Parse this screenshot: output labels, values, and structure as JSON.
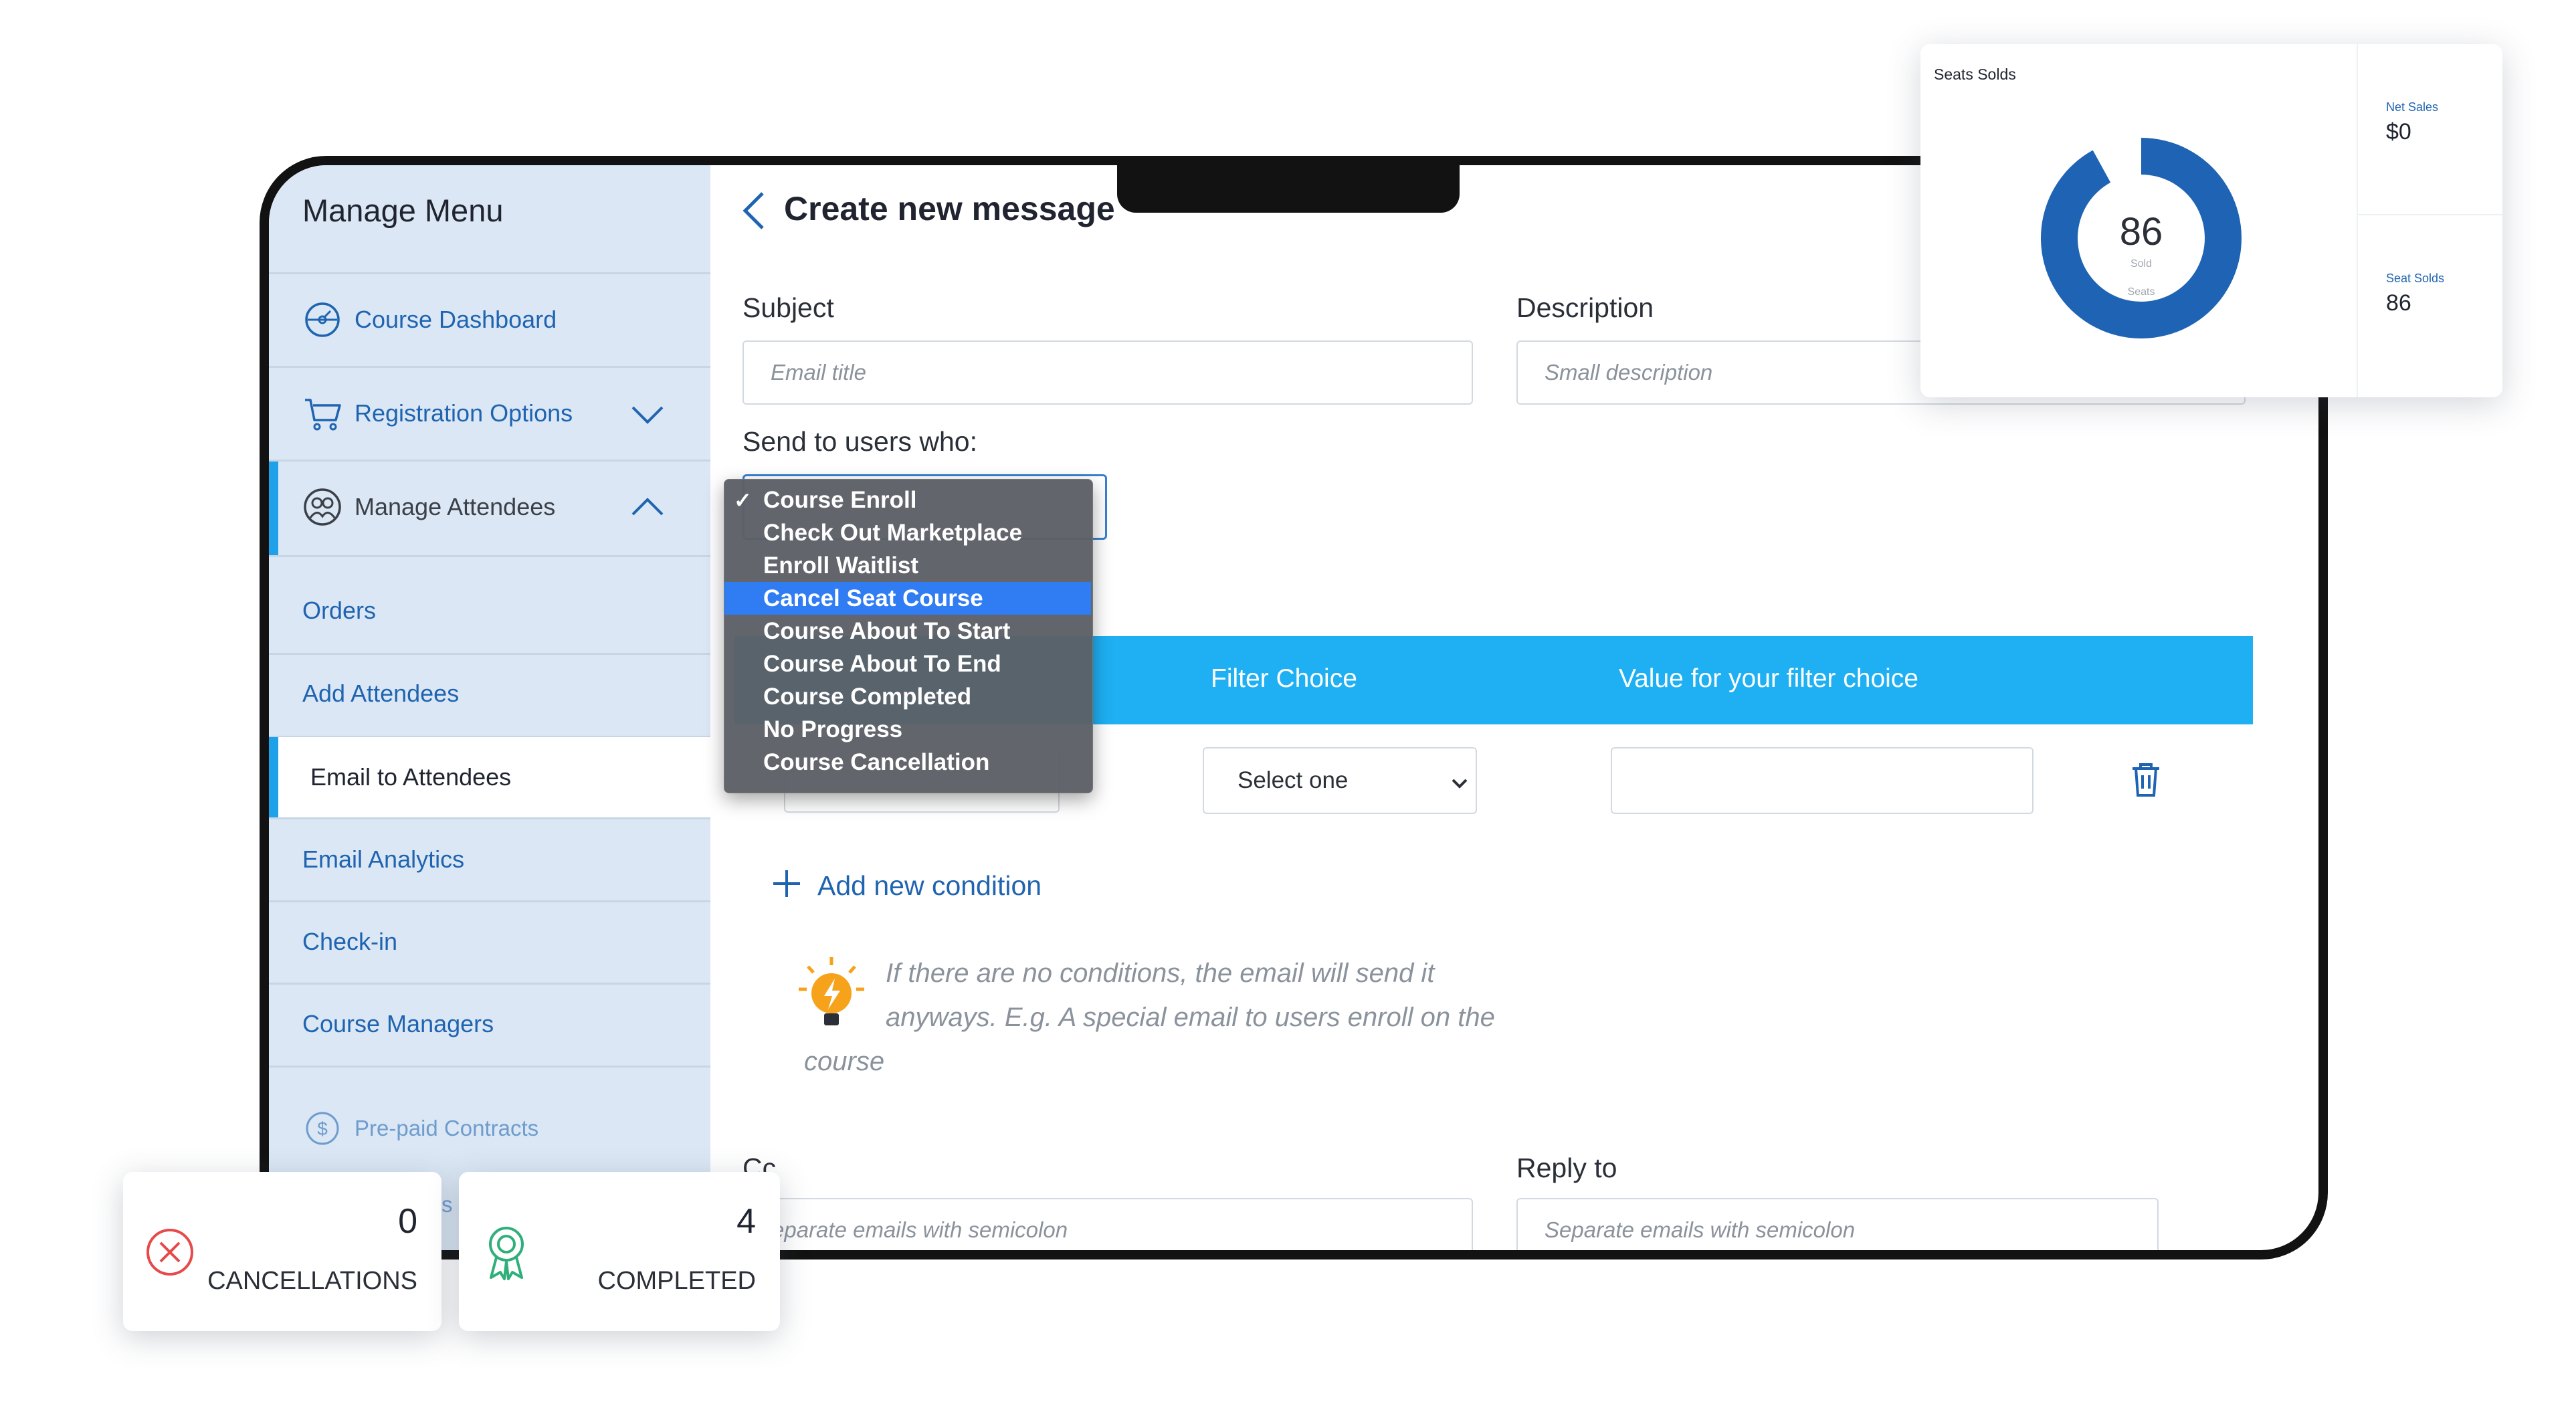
{
  "sidebar": {
    "title": "Manage Menu",
    "items": [
      {
        "label": "Course Dashboard",
        "icon": "dashboard-gauge-icon"
      },
      {
        "label": "Registration Options",
        "icon": "cart-icon"
      },
      {
        "label": "Manage Attendees",
        "icon": "attendees-icon"
      }
    ],
    "sub_items": [
      {
        "label": "Orders"
      },
      {
        "label": "Add Attendees"
      },
      {
        "label": "Email to Attendees",
        "active": true
      },
      {
        "label": "Email Analytics"
      },
      {
        "label": "Check-in"
      },
      {
        "label": "Course Managers"
      }
    ],
    "extra_item": {
      "label": "Pre-paid Contracts",
      "icon": "dollar-circle-icon"
    },
    "partial_label": "s"
  },
  "header": {
    "title": "Create new message"
  },
  "form": {
    "subject": {
      "label": "Subject",
      "placeholder": "Email title"
    },
    "description": {
      "label": "Description",
      "placeholder": "Small description"
    },
    "send_to": {
      "label": "Send to users who:"
    },
    "filter_header": {
      "filter_choice": "Filter Choice",
      "value": "Value for your filter choice"
    },
    "filter_select": {
      "value": "Select one"
    },
    "add_condition": "Add new condition",
    "hint": {
      "line1": "If there are no conditions, the email will send it",
      "line2": "anyways. E.g. A special email to users enroll on the",
      "line3": "course"
    },
    "cc": {
      "label": "Cc",
      "placeholder": "Separate emails with semicolon"
    },
    "reply_to": {
      "label": "Reply to",
      "placeholder": "Separate emails with semicolon"
    }
  },
  "dropdown": {
    "options": [
      {
        "label": "Course Enroll",
        "checked": true
      },
      {
        "label": "Check Out Marketplace"
      },
      {
        "label": "Enroll Waitlist"
      },
      {
        "label": "Cancel Seat Course",
        "highlighted": true
      },
      {
        "label": "Course About To Start"
      },
      {
        "label": "Course About To End"
      },
      {
        "label": "Course Completed"
      },
      {
        "label": "No Progress"
      },
      {
        "label": "Course Cancellation"
      }
    ]
  },
  "chart_card": {
    "title": "Seats Solds",
    "net_sales_label": "Net Sales",
    "net_sales_value": "$0",
    "seat_solds_label": "Seat Solds",
    "seat_solds_value": "86"
  },
  "chart_data": {
    "type": "pie",
    "title": "Seats Solds",
    "center_value": "86",
    "center_sub1": "Sold",
    "center_sub2": "Seats",
    "slices": [
      {
        "label": "Sold",
        "value": 0.92,
        "color": "#1e63b4"
      },
      {
        "label": "Remaining",
        "value": 0.08,
        "color": "#ffffff"
      }
    ]
  },
  "stats": [
    {
      "label": "CANCELLATIONS",
      "value": "0",
      "icon": "x-circle-icon",
      "color": "#e64a4a"
    },
    {
      "label": "COMPLETED",
      "value": "4",
      "icon": "award-ribbon-icon",
      "color": "#2faf7a"
    }
  ],
  "colors": {
    "accent": "#1eb0f3",
    "link": "#1f64b0",
    "sidebar_bg": "#dbe7f4",
    "highlight": "#2f7cf3"
  }
}
